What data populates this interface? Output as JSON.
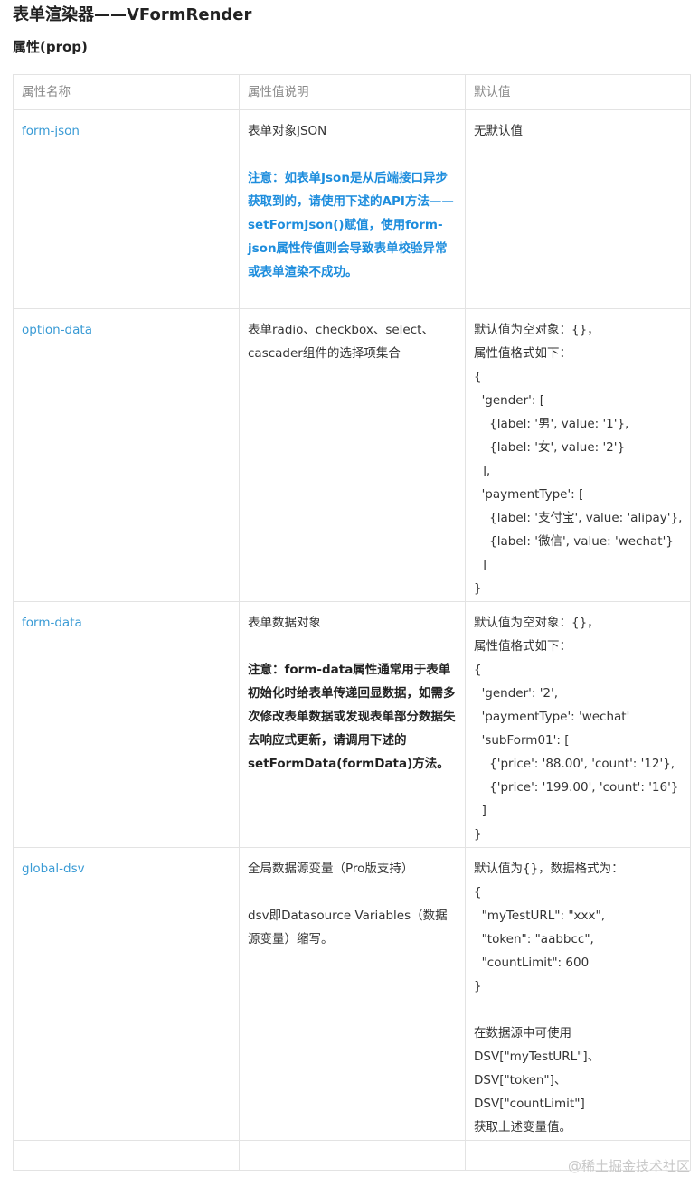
{
  "page_title": "表单渲染器——VFormRender",
  "section_title": "属性(prop)",
  "table": {
    "headers": [
      "属性名称",
      "属性值说明",
      "默认值"
    ],
    "rows": [
      {
        "name": "form-json",
        "desc": "表单对象JSON",
        "note": "注意：如表单Json是从后端接口异步获取到的，请使用下述的API方法——setFormJson()赋值，使用form-json属性传值则会导致表单校验异常或表单渲染不成功。",
        "default_lines": [
          "无默认值"
        ]
      },
      {
        "name": "option-data",
        "desc": "表单radio、checkbox、select、cascader组件的选择项集合",
        "default_lines": [
          "默认值为空对象：{}，",
          "属性值格式如下：",
          "{",
          "  'gender': [",
          "    {label: '男', value: '1'},",
          "    {label: '女', value: '2'}",
          "  ],",
          "  'paymentType': [",
          "    {label: '支付宝', value: 'alipay'},",
          "    {label: '微信', value: 'wechat'}",
          "  ]",
          "}"
        ]
      },
      {
        "name": "form-data",
        "desc": "表单数据对象",
        "note": "注意：form-data属性通常用于表单初始化时给表单传递回显数据，如需多次修改表单数据或发现表单部分数据失去响应式更新，请调用下述的setFormData(formData)方法。",
        "default_lines": [
          "默认值为空对象：{}，",
          "属性值格式如下：",
          "{",
          "  'gender': '2',",
          "  'paymentType': 'wechat'",
          "  'subForm01': [",
          "    {'price': '88.00', 'count': '12'},",
          "    {'price': '199.00', 'count': '16'}",
          "  ]",
          "}"
        ]
      },
      {
        "name": "global-dsv",
        "desc": "全局数据源变量（Pro版支持）",
        "desc2": "dsv即Datasource Variables（数据源变量）缩写。",
        "default_lines": [
          "默认值为{}，数据格式为：",
          "{",
          "  \"myTestURL\": \"xxx\",",
          "  \"token\": \"aabbcc\",",
          "  \"countLimit\": 600",
          "}",
          "",
          "在数据源中可使用",
          "DSV[\"myTestURL\"]、",
          "DSV[\"token\"]、",
          "DSV[\"countLimit\"]",
          "获取上述变量值。"
        ]
      }
    ]
  },
  "watermark": "@稀土掘金技术社区"
}
